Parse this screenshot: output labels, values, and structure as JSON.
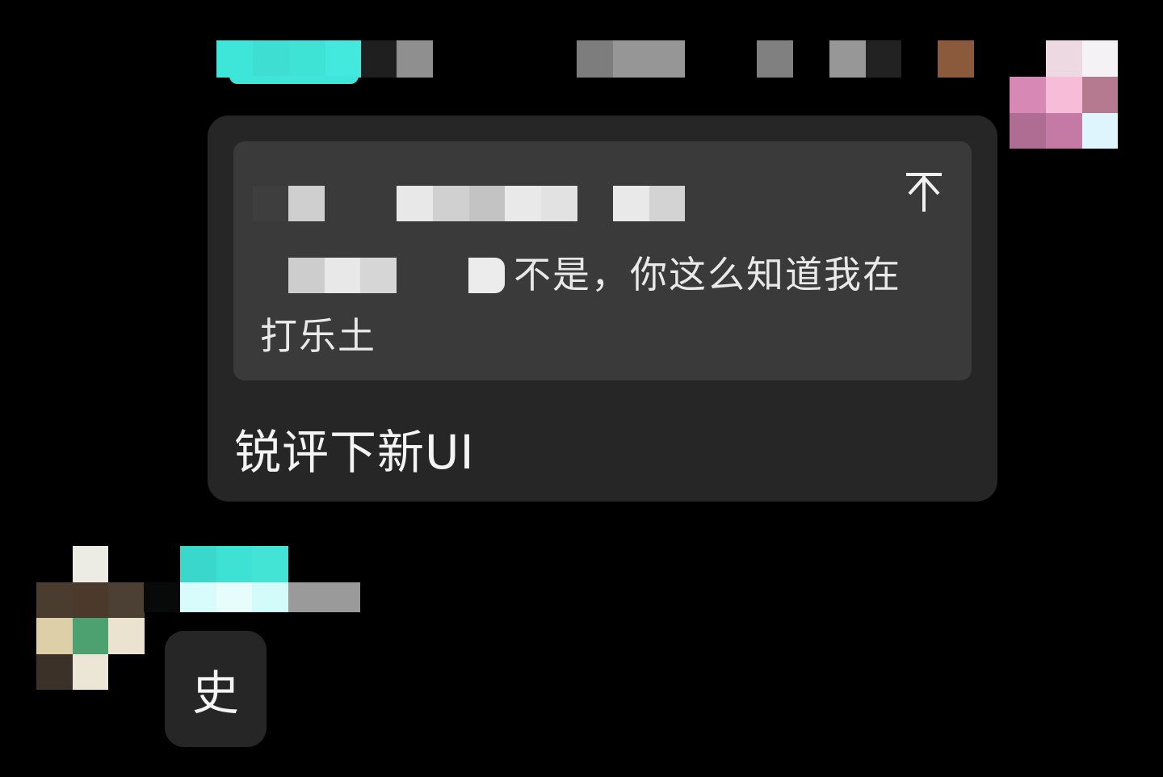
{
  "messages": [
    {
      "quote": {
        "line1": "不是，你这么知道我在",
        "line2": "打乐土",
        "jump_icon": "jump-to-top-icon"
      },
      "text": "锐评下新UI"
    },
    {
      "text": "史"
    }
  ],
  "colors": {
    "background": "#000000",
    "bubble": "#262626",
    "quote_box": "#3a3a3a",
    "text": "#f4f4f4",
    "accent_name": "#3fe0d2"
  }
}
